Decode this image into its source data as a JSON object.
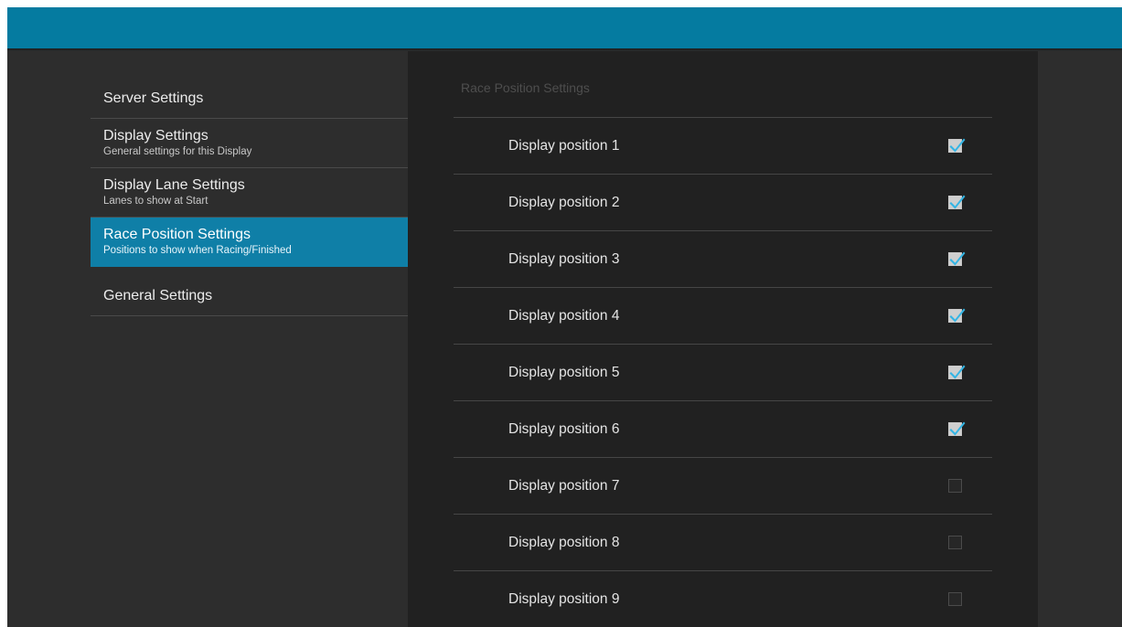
{
  "colors": {
    "action_bar": "#057ba0",
    "selected_header": "#0f7fa7",
    "check_accent": "#33b5e5"
  },
  "headers": [
    {
      "title": "Server Settings",
      "summary": "",
      "selected": false
    },
    {
      "title": "Display Settings",
      "summary": "General settings for this Display",
      "selected": false
    },
    {
      "title": "Display Lane Settings",
      "summary": "Lanes to show at Start",
      "selected": false
    },
    {
      "title": "Race Position Settings",
      "summary": "Positions to show when Racing/Finished",
      "selected": true
    },
    {
      "title": "General Settings",
      "summary": "",
      "selected": false
    }
  ],
  "panel": {
    "category_title": "Race Position Settings",
    "preferences": [
      {
        "label": "Display position 1",
        "checked": true
      },
      {
        "label": "Display position 2",
        "checked": true
      },
      {
        "label": "Display position 3",
        "checked": true
      },
      {
        "label": "Display position 4",
        "checked": true
      },
      {
        "label": "Display position 5",
        "checked": true
      },
      {
        "label": "Display position 6",
        "checked": true
      },
      {
        "label": "Display position 7",
        "checked": false
      },
      {
        "label": "Display position 8",
        "checked": false
      },
      {
        "label": "Display position 9",
        "checked": false
      }
    ]
  }
}
